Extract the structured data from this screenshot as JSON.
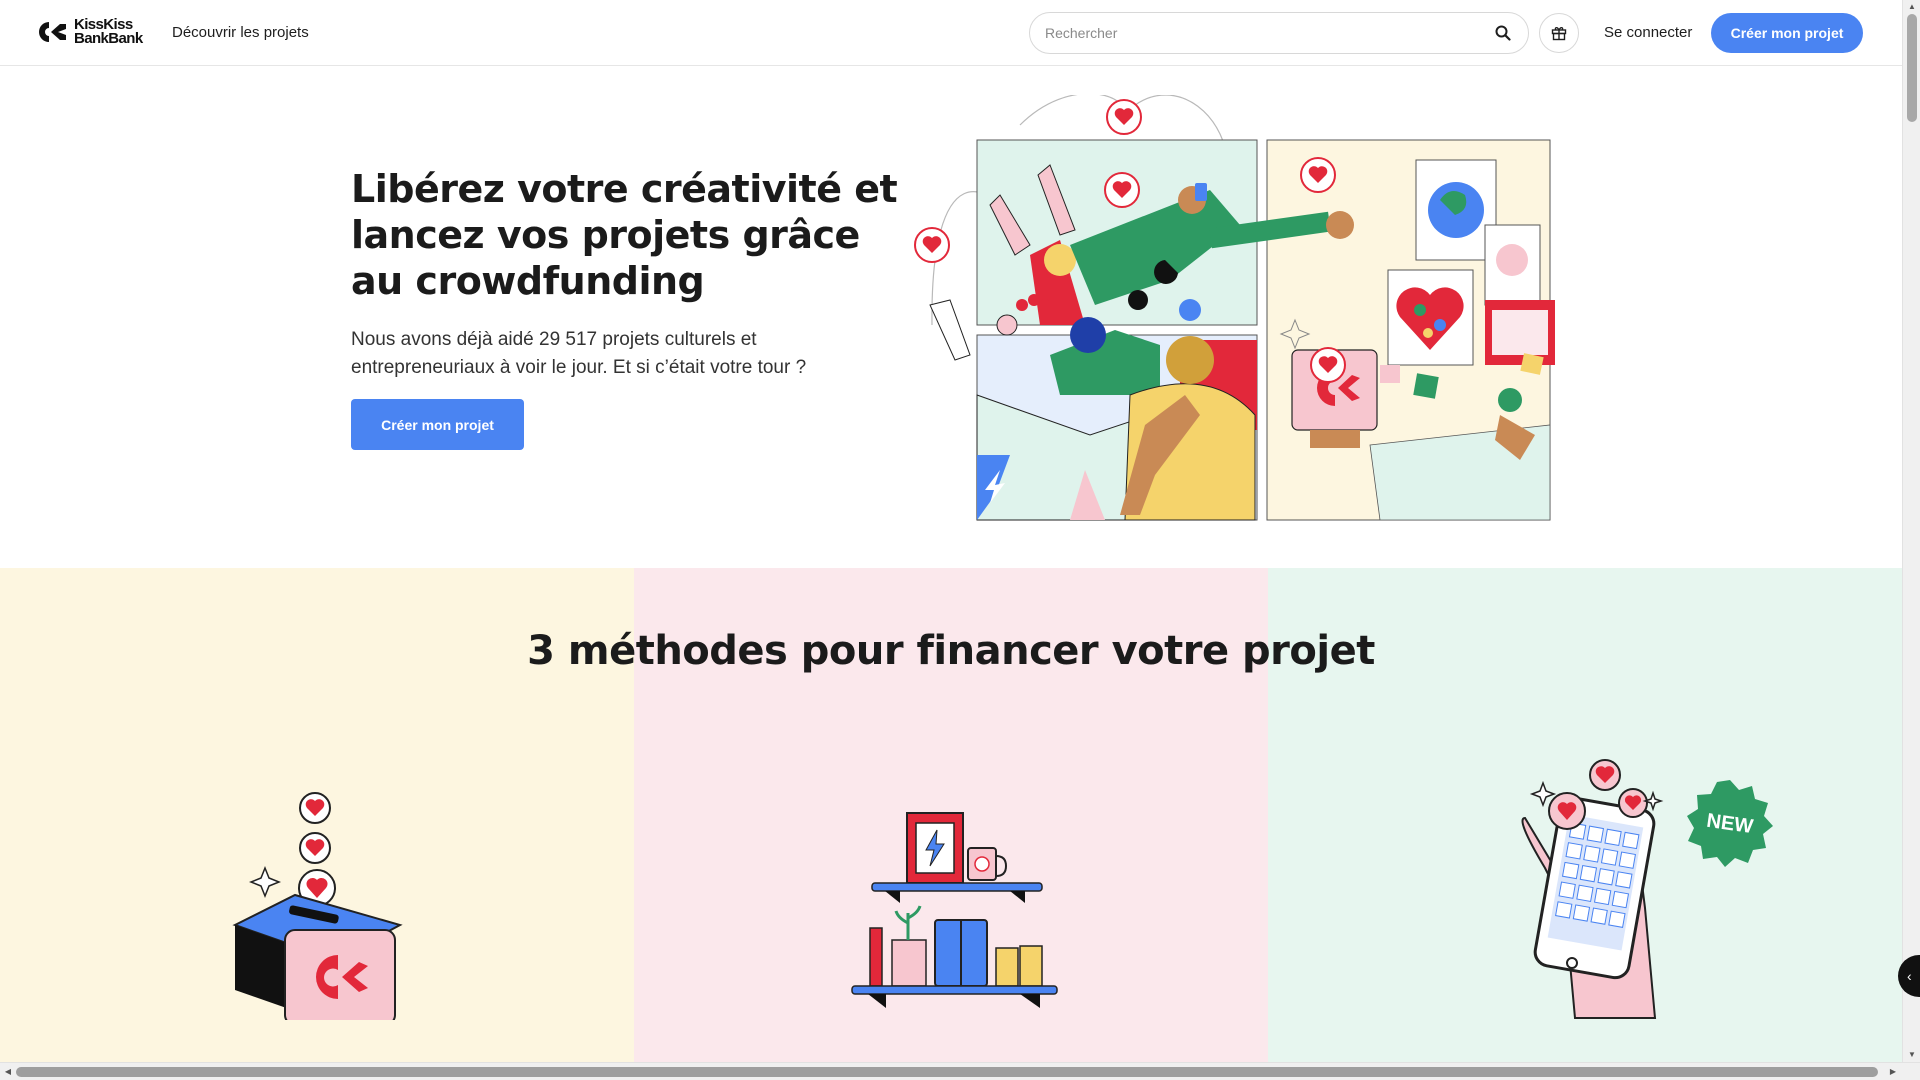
{
  "header": {
    "logo_line1": "KissKiss",
    "logo_line2": "BankBank",
    "discover_label": "Découvrir les projets",
    "search_placeholder": "Rechercher",
    "login_label": "Se connecter",
    "create_label": "Créer mon projet"
  },
  "hero": {
    "title": "Libérez votre créativité et lancez vos projets grâce au crowdfunding",
    "subtitle": "Nous avons déjà aidé 29 517 projets culturels et entrepreneuriaux à voir le jour. Et si c’était votre tour ?",
    "cta_label": "Créer mon projet"
  },
  "methods": {
    "title": "3 méthodes pour financer votre projet",
    "badge": "NEW"
  },
  "colors": {
    "accent": "#4a84f2",
    "brand_red": "#e2283a",
    "col1_bg": "#fdf6e0",
    "col2_bg": "#fbe8ec",
    "col3_bg": "#e7f6ef",
    "badge_green": "#2e9a63"
  }
}
